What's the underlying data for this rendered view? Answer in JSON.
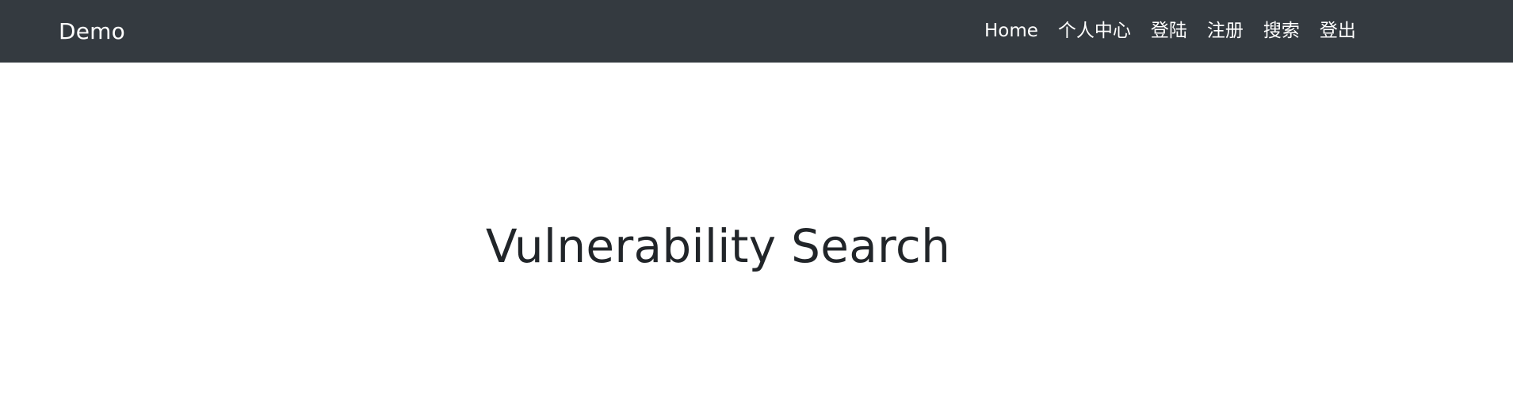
{
  "navbar": {
    "brand": "Demo",
    "links": [
      {
        "label": "Home"
      },
      {
        "label": "个人中心"
      },
      {
        "label": "登陆"
      },
      {
        "label": "注册"
      },
      {
        "label": "搜索"
      },
      {
        "label": "登出"
      }
    ],
    "background_color": "#343a40",
    "text_color": "#ffffff"
  },
  "main": {
    "title": "Vulnerability Search",
    "title_color": "#212529"
  }
}
